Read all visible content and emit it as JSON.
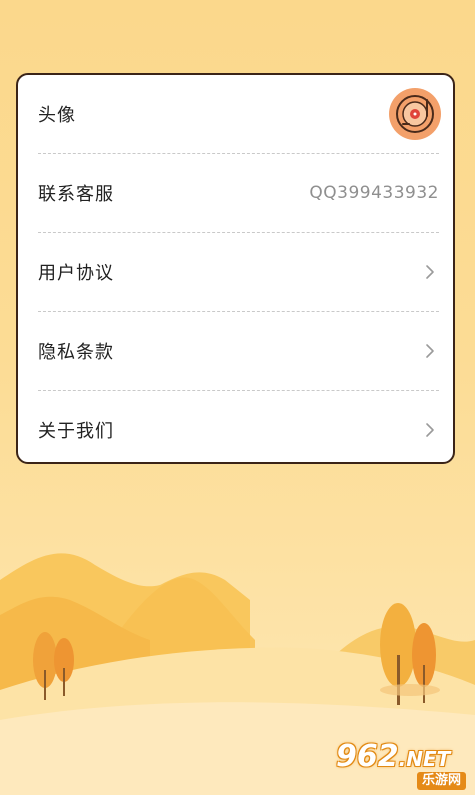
{
  "settings": {
    "items": [
      {
        "label": "头像",
        "type": "avatar"
      },
      {
        "label": "联系客服",
        "value": "QQ399433932"
      },
      {
        "label": "用户协议",
        "type": "link"
      },
      {
        "label": "隐私条款",
        "type": "link"
      },
      {
        "label": "关于我们",
        "type": "link"
      }
    ]
  },
  "watermark": {
    "brand": "962",
    "domain": ".NET",
    "site": "乐游网"
  },
  "colors": {
    "background_top": "#fbd88c",
    "card_border": "#3b2418",
    "avatar_bg": "#f3a06a",
    "watermark_orange": "#e58a17"
  },
  "icons": {
    "avatar": "vinyl-record-icon",
    "chevron": "chevron-right-icon"
  }
}
